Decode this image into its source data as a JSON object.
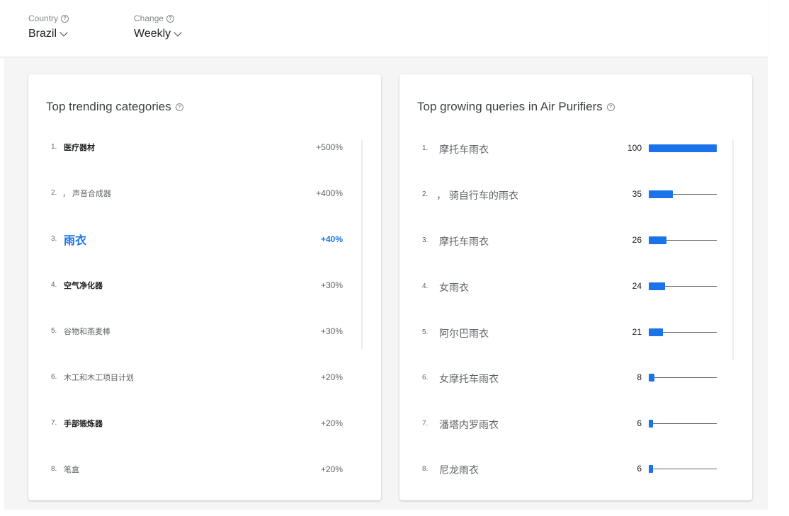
{
  "filters": {
    "country": {
      "label": "Country",
      "value": "Brazil"
    },
    "change": {
      "label": "Change",
      "value": "Weekly"
    }
  },
  "categories_card": {
    "title": "Top trending categories",
    "items": [
      {
        "rank": "1.",
        "name": "医疗器材",
        "change": "+500%"
      },
      {
        "rank": "2.",
        "name": "， 声音合成器",
        "change": "+400%"
      },
      {
        "rank": "3.",
        "name": "雨衣",
        "change": "+40%"
      },
      {
        "rank": "4.",
        "name": "空气净化器",
        "change": "+30%"
      },
      {
        "rank": "5.",
        "name": "谷物和燕麦棒",
        "change": "+30%"
      },
      {
        "rank": "6.",
        "name": "木工和木工项目计划",
        "change": "+20%"
      },
      {
        "rank": "7.",
        "name": "手部锻炼器",
        "change": "+20%"
      },
      {
        "rank": "8.",
        "name": "笔盒",
        "change": "+20%"
      }
    ]
  },
  "queries_card": {
    "title": "Top growing queries in Air Purifiers",
    "items": [
      {
        "rank": "1.",
        "name": "摩托车雨衣",
        "value": "100",
        "level": 100
      },
      {
        "rank": "2.",
        "name": "， 骑自行车的雨衣",
        "value": "35",
        "level": 35
      },
      {
        "rank": "3.",
        "name": "摩托车雨衣",
        "value": "26",
        "level": 26
      },
      {
        "rank": "4.",
        "name": "女雨衣",
        "value": "24",
        "level": 24
      },
      {
        "rank": "5.",
        "name": "阿尔巴雨衣",
        "value": "21",
        "level": 21
      },
      {
        "rank": "6.",
        "name": "女摩托车雨衣",
        "value": "8",
        "level": 8
      },
      {
        "rank": "7.",
        "name": "潘塔内罗雨衣",
        "value": "6",
        "level": 6
      },
      {
        "rank": "8.",
        "name": "尼龙雨衣",
        "value": "6",
        "level": 6
      }
    ]
  },
  "colors": {
    "accent": "#1a73e8",
    "bar": "#1a73e8"
  },
  "icons": {
    "help": "question-circle-icon",
    "dropdown": "chevron-down-icon"
  }
}
